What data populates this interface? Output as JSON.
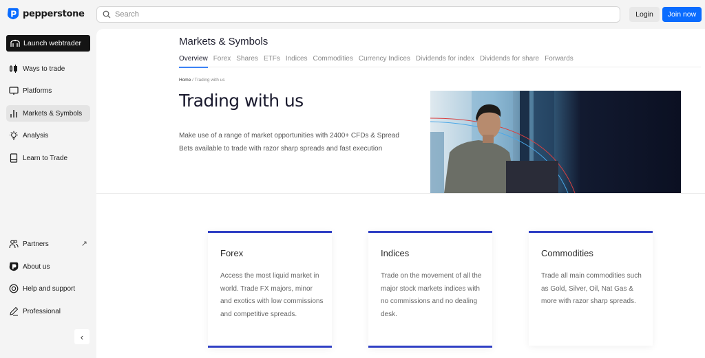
{
  "header": {
    "brand": "pepperstone",
    "search_placeholder": "Search",
    "login_label": "Login",
    "join_label": "Join now"
  },
  "sidebar": {
    "launch_label": "Launch webtrader",
    "items": [
      {
        "label": "Ways to trade",
        "icon": "candlestick-icon"
      },
      {
        "label": "Platforms",
        "icon": "monitor-icon"
      },
      {
        "label": "Markets & Symbols",
        "icon": "bar-chart-icon",
        "active": true
      },
      {
        "label": "Analysis",
        "icon": "lightbulb-icon"
      },
      {
        "label": "Learn to Trade",
        "icon": "book-icon"
      }
    ],
    "bottom_items": [
      {
        "label": "Partners",
        "icon": "users-icon",
        "external": true
      },
      {
        "label": "About us",
        "icon": "pepperstone-logo-icon"
      },
      {
        "label": "Help and support",
        "icon": "lifebuoy-icon"
      },
      {
        "label": "Professional",
        "icon": "pen-icon"
      }
    ],
    "collapse_icon": "chevron-left-icon"
  },
  "main": {
    "title": "Markets & Symbols",
    "tabs": [
      {
        "label": "Overview",
        "active": true
      },
      {
        "label": "Forex"
      },
      {
        "label": "Shares"
      },
      {
        "label": "ETFs"
      },
      {
        "label": "Indices"
      },
      {
        "label": "Commodities"
      },
      {
        "label": "Currency Indices"
      },
      {
        "label": "Dividends for index"
      },
      {
        "label": "Dividends for share"
      },
      {
        "label": "Forwards"
      }
    ],
    "breadcrumb": {
      "home": "Home",
      "separator": " / ",
      "current": "Trading with us"
    },
    "hero": {
      "title": "Trading with us",
      "description": "Make use of a range of market opportunities with 2400+ CFDs & Spread Bets available to trade with razor sharp spreads and fast execution",
      "image_alt": "Man working on laptop in front of city buildings"
    },
    "cards": [
      {
        "title": "Forex",
        "description": "Access the most liquid market in world. Trade FX majors, minor and exotics with low commissions and competitive spreads."
      },
      {
        "title": "Indices",
        "description": "Trade on the movement of all the major stock markets indices with no commissions and no dealing desk."
      },
      {
        "title": "Commodities",
        "description": "Trade all main commodities such as Gold, Silver, Oil, Nat Gas & more with razor sharp spreads."
      }
    ]
  },
  "colors": {
    "accent_blue": "#0a6cff",
    "card_border": "#2f3fc4",
    "tab_underline": "#3b82f6"
  }
}
